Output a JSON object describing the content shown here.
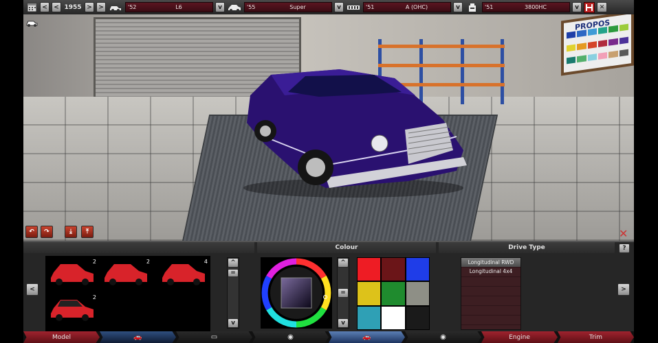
{
  "topbar": {
    "year": "1955",
    "chassis": {
      "year": "'52",
      "value": "L6"
    },
    "body": {
      "year": "'55",
      "value": "Super"
    },
    "engine": {
      "year": "'51",
      "value": "A (OHC)"
    },
    "engine_block": {
      "year": "'51",
      "value": "3800HC"
    }
  },
  "scene": {
    "board_title": "PROPOS",
    "board_colors": [
      "#1f3fa8",
      "#2d68c4",
      "#3e9bd6",
      "#23a38a",
      "#2d9a3d",
      "#9ccc3a",
      "#e0d22e",
      "#e59a22",
      "#d4452a",
      "#b02a3c",
      "#7a2a8c",
      "#4c3299",
      "#1a7a6e",
      "#53b06c",
      "#8ad0e0",
      "#f2a0b8",
      "#c8a070",
      "#5a5a5a"
    ]
  },
  "panel": {
    "colour_header": "Colour",
    "drive_header": "Drive Type",
    "models": [
      {
        "doors": "2",
        "color": "#d8232a",
        "roof": "#d8232a"
      },
      {
        "doors": "2",
        "color": "#d8232a",
        "roof": "#d8232a"
      },
      {
        "doors": "4",
        "color": "#d8232a",
        "roof": "#d8232a"
      },
      {
        "doors": "2",
        "color": "#d8232a",
        "roof": "#222222"
      }
    ],
    "swatches": [
      "#ee1c24",
      "#6b1518",
      "#1f3de8",
      "#ddc21a",
      "#1f8b2e",
      "#8e8f86",
      "#2fa0b5",
      "#ffffff",
      "#1a1a1a"
    ],
    "drive_options": [
      "Longitudinal RWD",
      "Longitudinal 4x4"
    ]
  },
  "tabs": [
    {
      "label": "Model",
      "style": "red"
    },
    {
      "label": "",
      "style": "blue"
    },
    {
      "label": "",
      "style": "dark"
    },
    {
      "label": "",
      "style": "dark"
    },
    {
      "label": "",
      "style": "active"
    },
    {
      "label": "",
      "style": "dark"
    },
    {
      "label": "Engine",
      "style": "red"
    },
    {
      "label": "Trim",
      "style": "red"
    }
  ]
}
